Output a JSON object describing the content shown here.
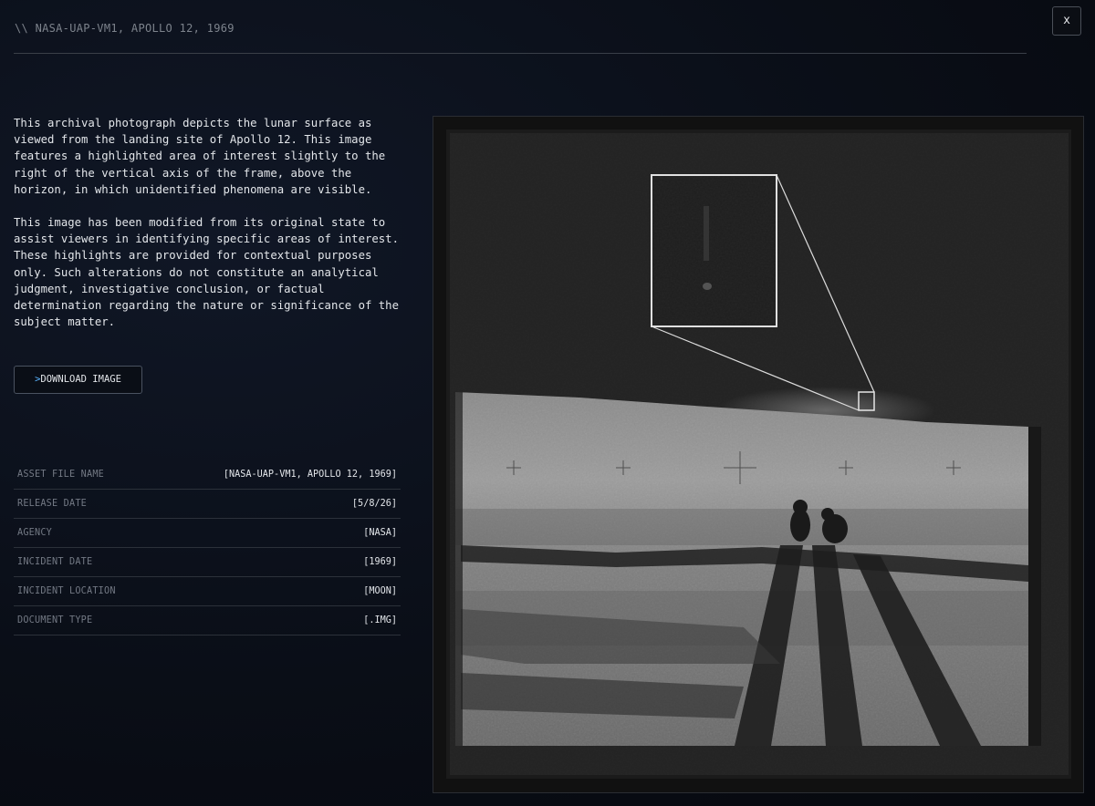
{
  "header": {
    "title": "\\\\  NASA-UAP-VM1, APOLLO 12, 1969",
    "close_label": "x"
  },
  "description": {
    "paragraph_1": "This archival photograph depicts the lunar surface as viewed from the landing site of Apollo 12. This image features a highlighted area of interest slightly to the right of the vertical axis of the frame, above the horizon, in which unidentified phenomena are visible.",
    "paragraph_2": "This image has been modified from its original state to assist viewers in identifying specific areas of interest. These highlights are provided for contextual purposes only. Such alterations do not constitute an analytical judgment, investigative conclusion, or factual determination regarding the nature or significance of the subject matter."
  },
  "download": {
    "prefix": ">",
    "label": "DOWNLOAD IMAGE"
  },
  "metadata": [
    {
      "label": "ASSET FILE NAME",
      "value": "[NASA-UAP-VM1, APOLLO 12, 1969]"
    },
    {
      "label": "RELEASE DATE",
      "value": "[5/8/26]"
    },
    {
      "label": "AGENCY",
      "value": "[NASA]"
    },
    {
      "label": "INCIDENT DATE",
      "value": "[1969]"
    },
    {
      "label": "INCIDENT LOCATION",
      "value": "[MOON]"
    },
    {
      "label": "DOCUMENT TYPE",
      "value": "[.IMG]"
    }
  ],
  "colors": {
    "background": "#080b12",
    "accent": "#5ab4ff",
    "rule": "#3a3f48"
  }
}
